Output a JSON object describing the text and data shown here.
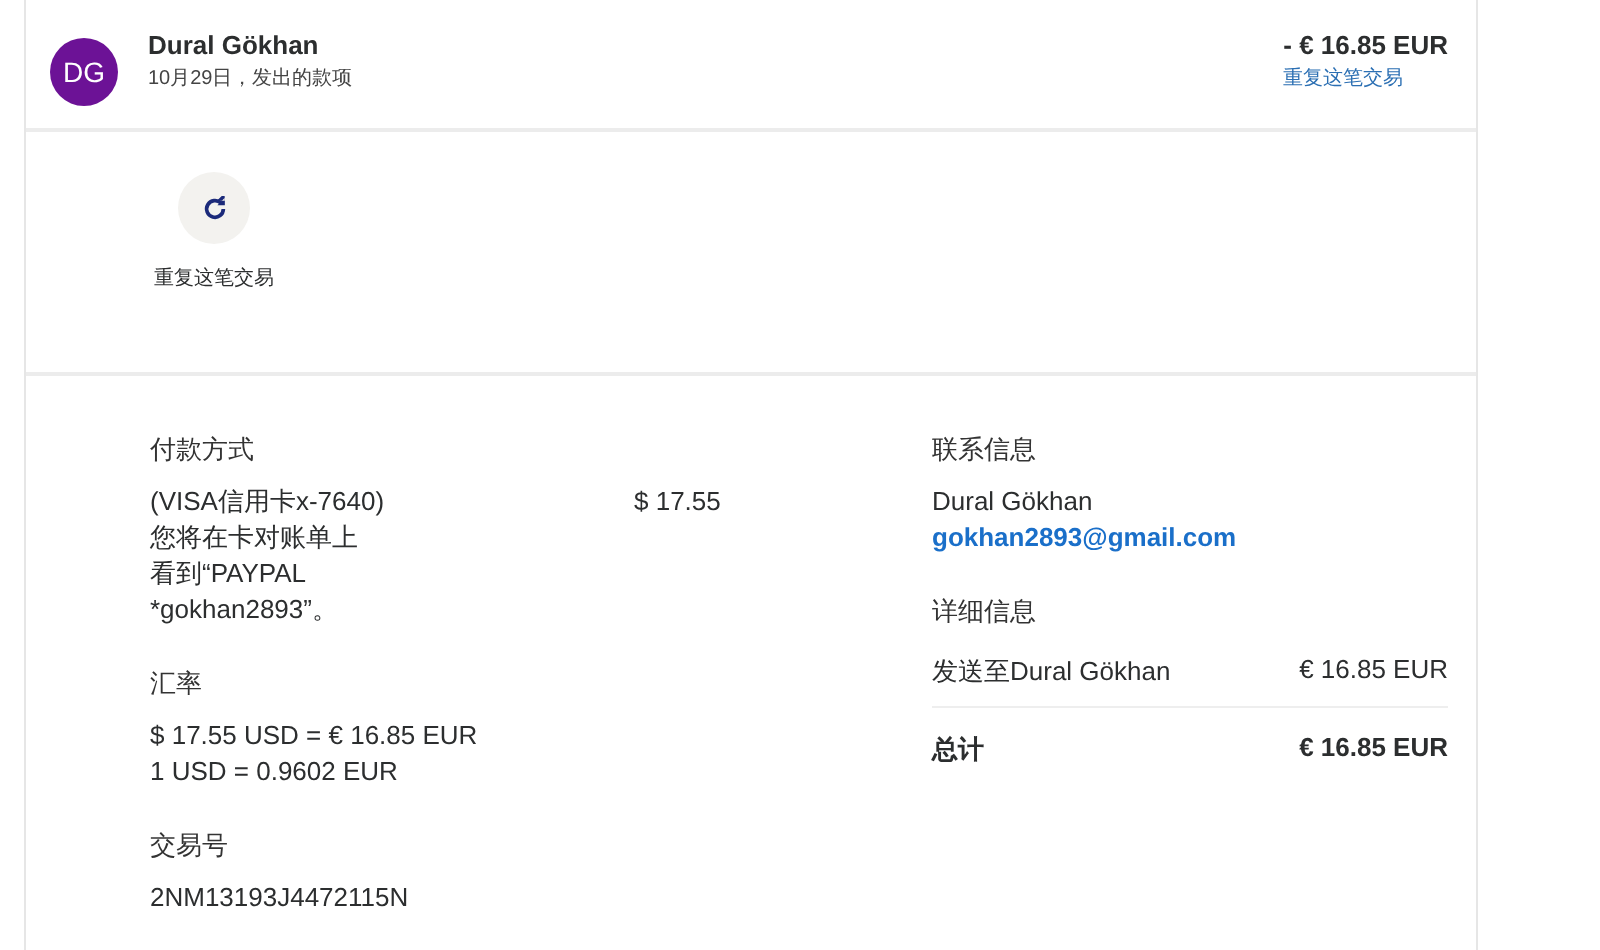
{
  "header": {
    "avatar_initials": "DG",
    "name": "Dural Gökhan",
    "subtitle": "10月29日，发出的款项",
    "amount": "- € 16.85 EUR",
    "link": "重复这笔交易"
  },
  "actions": [
    {
      "kind": "repeat",
      "label": "重复这笔交易"
    }
  ],
  "payment": {
    "heading": "付款方式",
    "method": "(VISA信用卡x-7640)",
    "note": "您将在卡对账单上看到“PAYPAL *gokhan2893”。",
    "amount": "$ 17.55"
  },
  "exchange": {
    "heading": "汇率",
    "lines": [
      "$ 17.55 USD = € 16.85 EUR",
      "1 USD = 0.9602 EUR"
    ]
  },
  "transaction": {
    "heading": "交易号",
    "id": "2NM13193J4472115N"
  },
  "contact": {
    "heading": "联系信息",
    "name": "Dural Gökhan",
    "email": "gokhan2893@gmail.com"
  },
  "details": {
    "heading": "详细信息",
    "rows": [
      {
        "kind": "item",
        "label": "发送至Dural Gökhan",
        "value": "€ 16.85 EUR"
      },
      {
        "kind": "total",
        "label": "总计",
        "value": "€ 16.85 EUR"
      }
    ]
  }
}
